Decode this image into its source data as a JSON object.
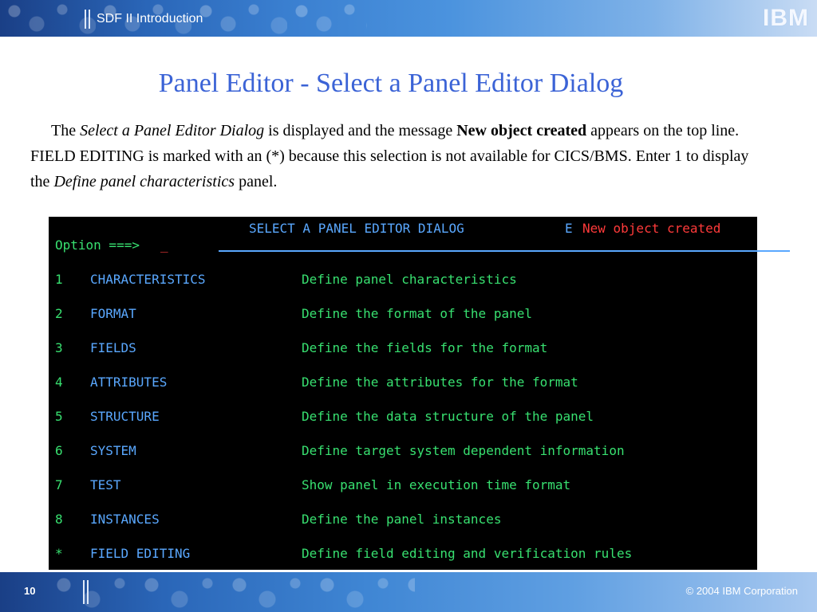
{
  "header": {
    "title": "SDF II  Introduction",
    "logo": "IBM"
  },
  "slide": {
    "title": "Panel Editor - Select a Panel Editor Dialog",
    "desc": {
      "p1": "The ",
      "p1_italic": "Select a Panel Editor Dialog",
      "p2": " is displayed and the message ",
      "p2_bold": "New object created",
      "p3": " appears on the top line. FIELD EDITING is marked with an (*) because this selection is not available for CICS/BMS. Enter 1 to display the ",
      "p3_italic": "Define panel characteristics",
      "p4": "  panel."
    }
  },
  "terminal": {
    "title": "SELECT A PANEL EDITOR DIALOG",
    "flag": "E",
    "message": "New object created",
    "option_label": "Option ===>",
    "cursor": "_",
    "options": [
      {
        "num": "1",
        "name": "CHARACTERISTICS",
        "desc": "Define panel characteristics"
      },
      {
        "num": "2",
        "name": "FORMAT",
        "desc": "Define the format of the panel"
      },
      {
        "num": "3",
        "name": "FIELDS",
        "desc": "Define the fields for the format"
      },
      {
        "num": "4",
        "name": "ATTRIBUTES",
        "desc": "Define the attributes for the format"
      },
      {
        "num": "5",
        "name": "STRUCTURE",
        "desc": "Define the data structure of the panel"
      },
      {
        "num": "6",
        "name": "SYSTEM",
        "desc": "Define target system dependent information"
      },
      {
        "num": "7",
        "name": "TEST",
        "desc": "Show panel in execution time format"
      },
      {
        "num": "8",
        "name": "INSTANCES",
        "desc": "Define the panel instances"
      },
      {
        "num": "*",
        "name": "FIELD EDITING",
        "desc": "Define field editing and verification rules"
      }
    ]
  },
  "footer": {
    "page": "10",
    "copyright": "© 2004 IBM Corporation"
  },
  "colors": {
    "title_blue": "#3b63d6",
    "terminal_bg": "#000000",
    "terminal_green": "#38e070",
    "terminal_blue": "#5aa8ff",
    "terminal_red": "#ff3a3a"
  }
}
